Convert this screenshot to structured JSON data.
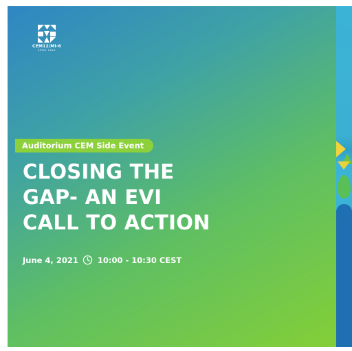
{
  "logo": {
    "name": "CEM12/MI-6",
    "sub": "CHILE 2021",
    "icon": "cem-logo-icon"
  },
  "event": {
    "tag": "Auditorium CEM Side Event",
    "title_lines": [
      "CLOSING THE",
      "GAP- AN EVI",
      "CALL TO ACTION"
    ],
    "date": "June 4, 2021",
    "time": "10:00 - 10:30 CEST",
    "clock_icon": "clock-icon"
  },
  "colors": {
    "gradient_top": "#2f86c4",
    "gradient_bottom": "#84cf37",
    "tag_bg": "#8cd03b",
    "strip_light": "#3bb3d6",
    "strip_dark": "#1f6fb3",
    "text": "#ffffff"
  }
}
